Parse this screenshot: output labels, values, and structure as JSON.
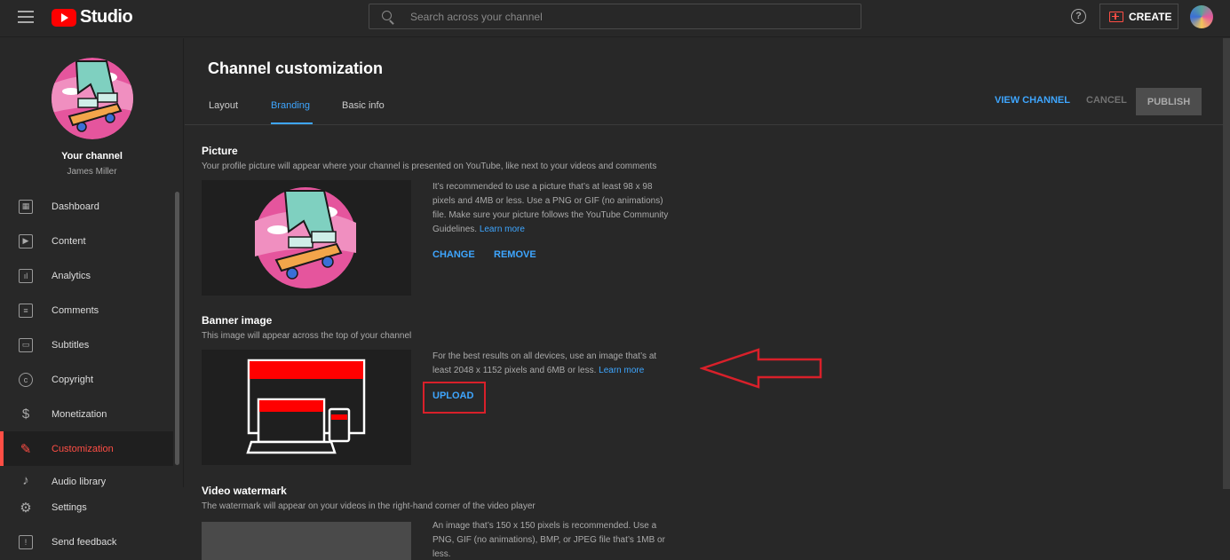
{
  "topbar": {
    "logo_text": "Studio",
    "search_placeholder": "Search across your channel",
    "help_glyph": "?",
    "create_label": "CREATE"
  },
  "sidebar": {
    "your_channel": "Your channel",
    "channel_name": "James Miller",
    "items": [
      {
        "label": "Dashboard",
        "icon": "dashboard-icon",
        "glyph": "▦"
      },
      {
        "label": "Content",
        "icon": "content-icon",
        "glyph": "▶"
      },
      {
        "label": "Analytics",
        "icon": "analytics-icon",
        "glyph": "ıl"
      },
      {
        "label": "Comments",
        "icon": "comments-icon",
        "glyph": "≡"
      },
      {
        "label": "Subtitles",
        "icon": "subtitles-icon",
        "glyph": "▭"
      },
      {
        "label": "Copyright",
        "icon": "copyright-icon",
        "glyph": "c"
      },
      {
        "label": "Monetization",
        "icon": "monetization-icon",
        "glyph": "$"
      },
      {
        "label": "Customization",
        "icon": "customization-icon",
        "glyph": "✎"
      },
      {
        "label": "Audio library",
        "icon": "audio-library-icon",
        "glyph": "♪"
      }
    ],
    "active_index": 7,
    "bottom_items": [
      {
        "label": "Settings",
        "icon": "settings-icon",
        "glyph": "⚙"
      },
      {
        "label": "Send feedback",
        "icon": "feedback-icon",
        "glyph": "!"
      }
    ]
  },
  "main": {
    "title": "Channel customization",
    "tabs": [
      {
        "label": "Layout"
      },
      {
        "label": "Branding"
      },
      {
        "label": "Basic info"
      }
    ],
    "active_tab": 1,
    "view_channel": "VIEW CHANNEL",
    "cancel": "CANCEL",
    "publish": "PUBLISH",
    "picture": {
      "title": "Picture",
      "desc": "Your profile picture will appear where your channel is presented on YouTube, like next to your videos and comments",
      "info": "It’s recommended to use a picture that’s at least 98 x 98 pixels and 4MB or less. Use a PNG or GIF (no animations) file. Make sure your picture follows the YouTube Community Guidelines.",
      "learn_more": "Learn more",
      "change": "CHANGE",
      "remove": "REMOVE"
    },
    "banner": {
      "title": "Banner image",
      "desc": "This image will appear across the top of your channel",
      "info": "For the best results on all devices, use an image that’s at least 2048 x 1152 pixels and 6MB or less.",
      "learn_more": "Learn more",
      "upload": "UPLOAD"
    },
    "watermark": {
      "title": "Video watermark",
      "desc": "The watermark will appear on your videos in the right-hand corner of the video player",
      "info": "An image that’s 150 x 150 pixels is recommended. Use a PNG, GIF (no animations), BMP, or JPEG file that’s 1MB or less."
    }
  },
  "colors": {
    "accent_blue": "#3ea6ff",
    "active_red": "#ff4e45",
    "annotation_red": "#d9202a",
    "background": "#282828"
  }
}
